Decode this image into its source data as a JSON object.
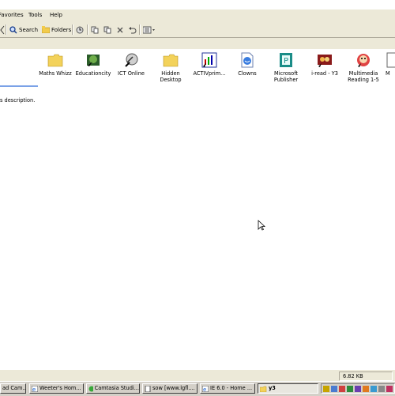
{
  "menubar": {
    "items": [
      "Favorites",
      "Tools",
      "Help"
    ]
  },
  "toolbar": {
    "search_label": "Search",
    "folders_label": "Folders"
  },
  "icons": [
    {
      "label": "Maths Whizz"
    },
    {
      "label": "Educationcity"
    },
    {
      "label": "ICT Online"
    },
    {
      "label": "Hidden Desktop"
    },
    {
      "label": "ACTIVprim..."
    },
    {
      "label": "Clowns"
    },
    {
      "label": "Microsoft Publisher"
    },
    {
      "label": "i-read - Y3"
    },
    {
      "label": "Multimedia Reading 1-5"
    },
    {
      "label": "M"
    }
  ],
  "description_text": "s description.",
  "status": {
    "size": "6.82 KB"
  },
  "taskbar": {
    "tasks": [
      "ad Cam...",
      "Weeter's Hom...",
      "Camtasia Studi...",
      "sow [www.lgfl....",
      "IE 6.0 - Home ...",
      "y3"
    ]
  },
  "colors": {
    "chrome": "#ece9d8",
    "accent_line": "#7ba2e7"
  }
}
